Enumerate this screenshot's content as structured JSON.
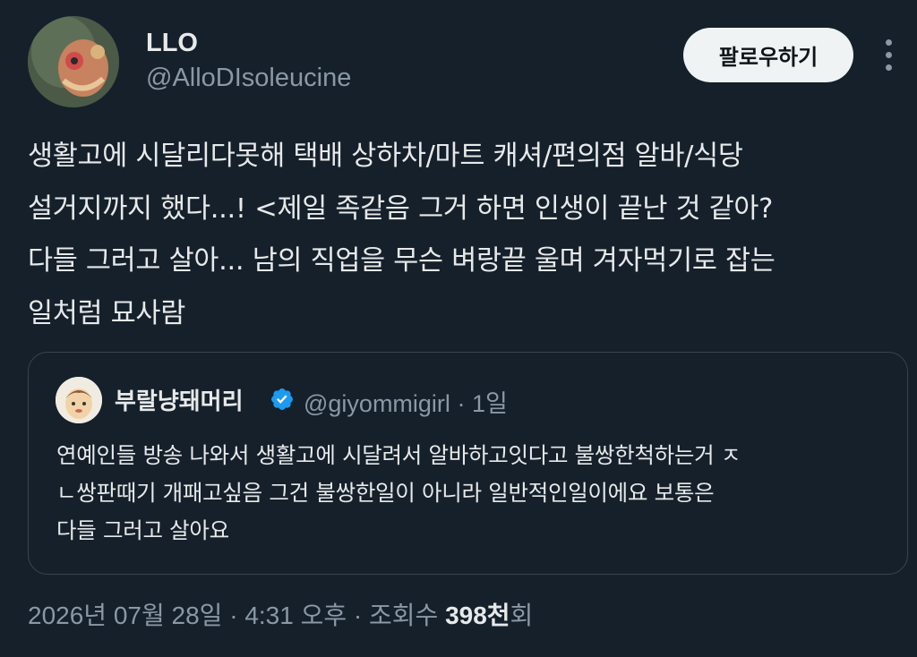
{
  "author": {
    "name": "LLO",
    "handle": "@AlloDIsoleucine"
  },
  "follow_label": "팔로우하기",
  "tweet_text": "생활고에 시달리다못해 택배 상하차/마트 캐셔/편의점 알바/식당\n설거지까지 했다...! <제일 족같음 그거 하면 인생이 끝난 것 같아?\n다들 그러고 살아... 남의 직업을 무슨 벼랑끝 울며 겨자먹기로 잡는\n일처럼 묘사람",
  "quote": {
    "name": "부랄냥돼머리",
    "handle": "@giyommigirl",
    "sep": "·",
    "time": "1일",
    "text": "연예인들 방송 나와서 생활고에 시달려서 알바하고잇다고 불쌍한척하는거 ㅈ\nㄴ쌍판때기 개패고싶음 그건 불쌍한일이 아니라 일반적인일이에요 보통은\n다들 그러고 살아요"
  },
  "meta": {
    "date": "2026년 07월 28일",
    "sep1": " · ",
    "time": "4:31 오후",
    "sep2": " · ",
    "views_label": "조회수 ",
    "views_count": "398천",
    "views_suffix": "회"
  },
  "colors": {
    "background": "#15202b",
    "verified": "#1d9bf0",
    "muted": "#8b98a5"
  },
  "icons": [
    "more-icon",
    "verified-icon"
  ]
}
